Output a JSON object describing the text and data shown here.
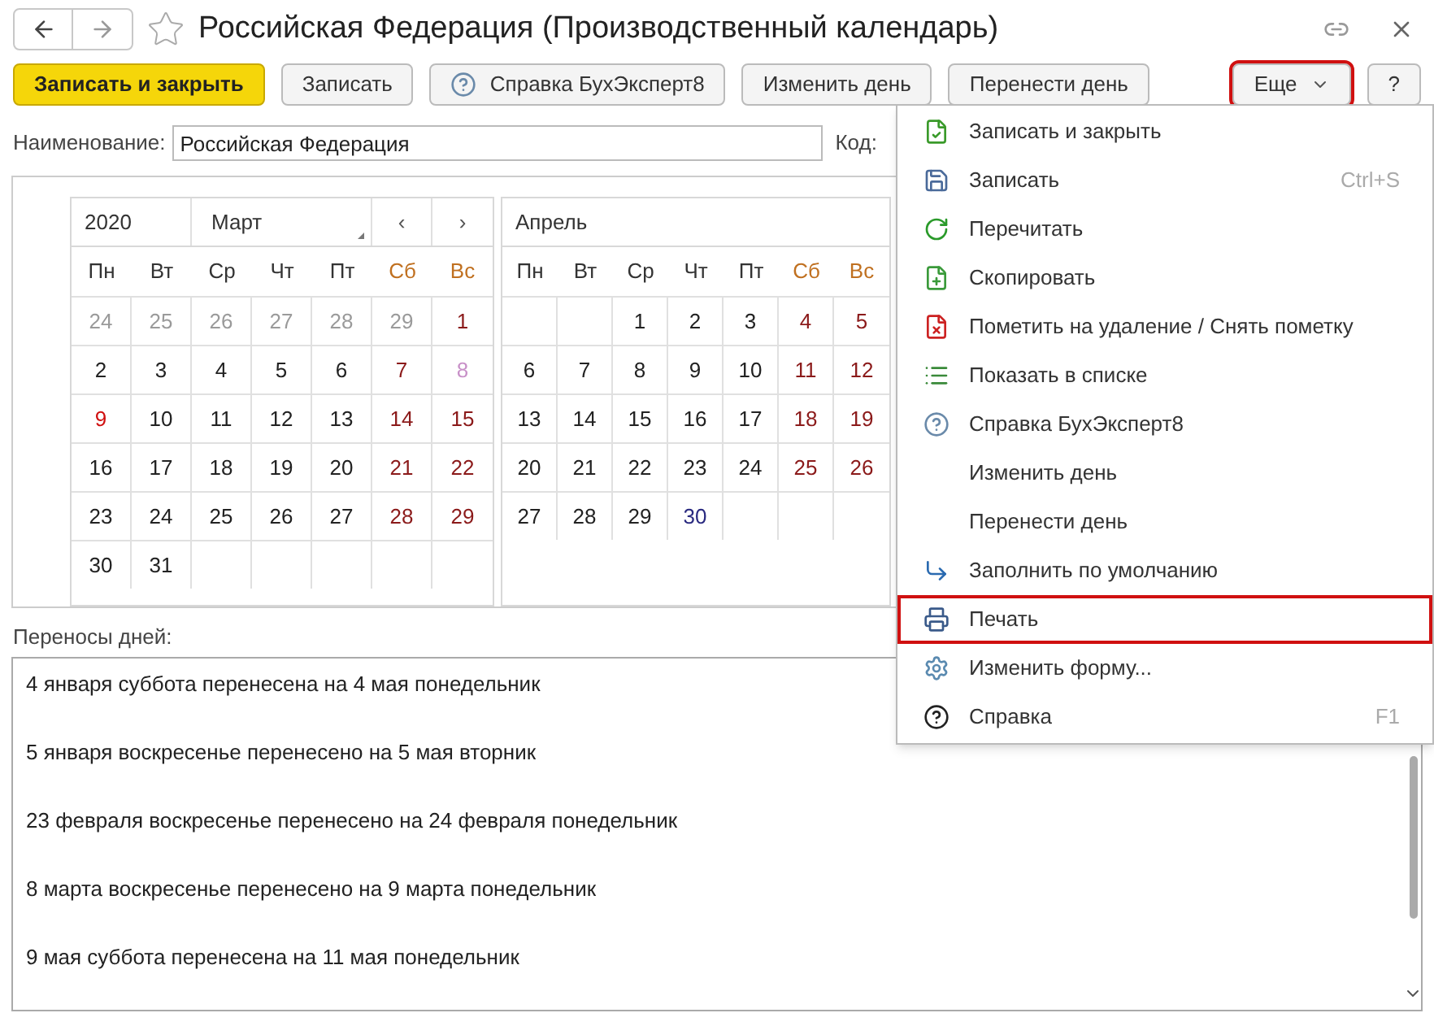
{
  "window": {
    "title": "Российская Федерация (Производственный календарь)"
  },
  "toolbar": [
    {
      "label": "Записать и закрыть",
      "kind": "primary",
      "framed": false
    },
    {
      "label": "Записать",
      "kind": "plain",
      "framed": false
    },
    {
      "label": "Справка БухЭксперт8",
      "kind": "help",
      "framed": false
    },
    {
      "label": "Изменить день",
      "kind": "plain",
      "framed": false
    },
    {
      "label": "Перенести день",
      "kind": "plain",
      "framed": false
    },
    {
      "label": "Еще",
      "kind": "more",
      "framed": true
    },
    {
      "label": "?",
      "kind": "plain",
      "framed": false
    }
  ],
  "name_field": {
    "label": "Наименование:",
    "value": "Российская Федерация",
    "code_label": "Код:"
  },
  "calendar": {
    "year": "2020",
    "prev": "‹",
    "next": "›",
    "months": [
      {
        "title": "Март",
        "weekdays": [
          {
            "label": "Пн",
            "weekend": false
          },
          {
            "label": "Вт",
            "weekend": false
          },
          {
            "label": "Ср",
            "weekend": false
          },
          {
            "label": "Чт",
            "weekend": false
          },
          {
            "label": "Пт",
            "weekend": false
          },
          {
            "label": "Сб",
            "weekend": true
          },
          {
            "label": "Вс",
            "weekend": true
          }
        ],
        "weeks": [
          [
            {
              "d": "24",
              "kind": "other"
            },
            {
              "d": "25",
              "kind": "other"
            },
            {
              "d": "26",
              "kind": "other"
            },
            {
              "d": "27",
              "kind": "other"
            },
            {
              "d": "28",
              "kind": "other"
            },
            {
              "d": "29",
              "kind": "other"
            },
            {
              "d": "1",
              "kind": "weekend"
            }
          ],
          [
            {
              "d": "2",
              "kind": "work"
            },
            {
              "d": "3",
              "kind": "work"
            },
            {
              "d": "4",
              "kind": "work"
            },
            {
              "d": "5",
              "kind": "work"
            },
            {
              "d": "6",
              "kind": "work"
            },
            {
              "d": "7",
              "kind": "weekend"
            },
            {
              "d": "8",
              "kind": "holiday"
            }
          ],
          [
            {
              "d": "9",
              "kind": "transfer"
            },
            {
              "d": "10",
              "kind": "work"
            },
            {
              "d": "11",
              "kind": "work"
            },
            {
              "d": "12",
              "kind": "work"
            },
            {
              "d": "13",
              "kind": "work"
            },
            {
              "d": "14",
              "kind": "weekend"
            },
            {
              "d": "15",
              "kind": "weekend"
            }
          ],
          [
            {
              "d": "16",
              "kind": "work"
            },
            {
              "d": "17",
              "kind": "work"
            },
            {
              "d": "18",
              "kind": "work"
            },
            {
              "d": "19",
              "kind": "work"
            },
            {
              "d": "20",
              "kind": "work"
            },
            {
              "d": "21",
              "kind": "weekend"
            },
            {
              "d": "22",
              "kind": "weekend"
            }
          ],
          [
            {
              "d": "23",
              "kind": "work"
            },
            {
              "d": "24",
              "kind": "work"
            },
            {
              "d": "25",
              "kind": "work"
            },
            {
              "d": "26",
              "kind": "work"
            },
            {
              "d": "27",
              "kind": "work"
            },
            {
              "d": "28",
              "kind": "weekend"
            },
            {
              "d": "29",
              "kind": "weekend"
            }
          ],
          [
            {
              "d": "30",
              "kind": "work"
            },
            {
              "d": "31",
              "kind": "work"
            },
            {
              "kind": "empty"
            },
            {
              "kind": "empty"
            },
            {
              "kind": "empty"
            },
            {
              "kind": "empty"
            },
            {
              "kind": "empty"
            }
          ]
        ]
      },
      {
        "title": "Апрель",
        "weekdays": [
          {
            "label": "Пн",
            "weekend": false
          },
          {
            "label": "Вт",
            "weekend": false
          },
          {
            "label": "Ср",
            "weekend": false
          },
          {
            "label": "Чт",
            "weekend": false
          },
          {
            "label": "Пт",
            "weekend": false
          },
          {
            "label": "Сб",
            "weekend": true
          },
          {
            "label": "Вс",
            "weekend": true
          }
        ],
        "weeks": [
          [
            {
              "kind": "empty"
            },
            {
              "kind": "empty"
            },
            {
              "d": "1",
              "kind": "work"
            },
            {
              "d": "2",
              "kind": "work"
            },
            {
              "d": "3",
              "kind": "work"
            },
            {
              "d": "4",
              "kind": "weekend"
            },
            {
              "d": "5",
              "kind": "weekend"
            }
          ],
          [
            {
              "d": "6",
              "kind": "work"
            },
            {
              "d": "7",
              "kind": "work"
            },
            {
              "d": "8",
              "kind": "work"
            },
            {
              "d": "9",
              "kind": "work"
            },
            {
              "d": "10",
              "kind": "work"
            },
            {
              "d": "11",
              "kind": "weekend"
            },
            {
              "d": "12",
              "kind": "weekend"
            }
          ],
          [
            {
              "d": "13",
              "kind": "work"
            },
            {
              "d": "14",
              "kind": "work"
            },
            {
              "d": "15",
              "kind": "work"
            },
            {
              "d": "16",
              "kind": "work"
            },
            {
              "d": "17",
              "kind": "work"
            },
            {
              "d": "18",
              "kind": "weekend"
            },
            {
              "d": "19",
              "kind": "weekend"
            }
          ],
          [
            {
              "d": "20",
              "kind": "work"
            },
            {
              "d": "21",
              "kind": "work"
            },
            {
              "d": "22",
              "kind": "work"
            },
            {
              "d": "23",
              "kind": "work"
            },
            {
              "d": "24",
              "kind": "work"
            },
            {
              "d": "25",
              "kind": "weekend"
            },
            {
              "d": "26",
              "kind": "weekend"
            }
          ],
          [
            {
              "d": "27",
              "kind": "work"
            },
            {
              "d": "28",
              "kind": "work"
            },
            {
              "d": "29",
              "kind": "work"
            },
            {
              "d": "30",
              "kind": "short"
            },
            {
              "kind": "empty"
            },
            {
              "kind": "empty"
            },
            {
              "kind": "empty"
            }
          ]
        ]
      }
    ]
  },
  "transfers": {
    "label": "Переносы дней:",
    "items": [
      "4 января суббота перенесена на 4 мая понедельник",
      "5 января воскресенье перенесено на 5 мая вторник",
      "23 февраля воскресенье перенесено на 24 февраля понедельник",
      "8 марта воскресенье перенесено на 9 марта понедельник",
      "9 мая суббота перенесена на 11 мая понедельник"
    ]
  },
  "menu": [
    {
      "label": "Записать и закрыть",
      "kind": "doc-check",
      "framed": false
    },
    {
      "label": "Записать",
      "kind": "save",
      "shortcut": "Ctrl+S",
      "framed": false
    },
    {
      "label": "Перечитать",
      "kind": "refresh",
      "framed": false
    },
    {
      "label": "Скопировать",
      "kind": "copy",
      "framed": false
    },
    {
      "label": "Пометить на удаление / Снять пометку",
      "kind": "delete",
      "framed": false
    },
    {
      "label": "Показать в списке",
      "kind": "list",
      "framed": false
    },
    {
      "label": "Справка БухЭксперт8",
      "kind": "help",
      "framed": false
    },
    {
      "label": "Изменить день",
      "kind": "plain",
      "framed": false
    },
    {
      "label": "Перенести день",
      "kind": "plain",
      "framed": false
    },
    {
      "label": "Заполнить по умолчанию",
      "kind": "fill",
      "framed": false
    },
    {
      "label": "Печать",
      "kind": "print",
      "framed": true
    },
    {
      "label": "Изменить форму...",
      "kind": "form",
      "framed": false
    },
    {
      "label": "Справка",
      "kind": "question",
      "shortcut": "F1",
      "framed": false
    }
  ]
}
